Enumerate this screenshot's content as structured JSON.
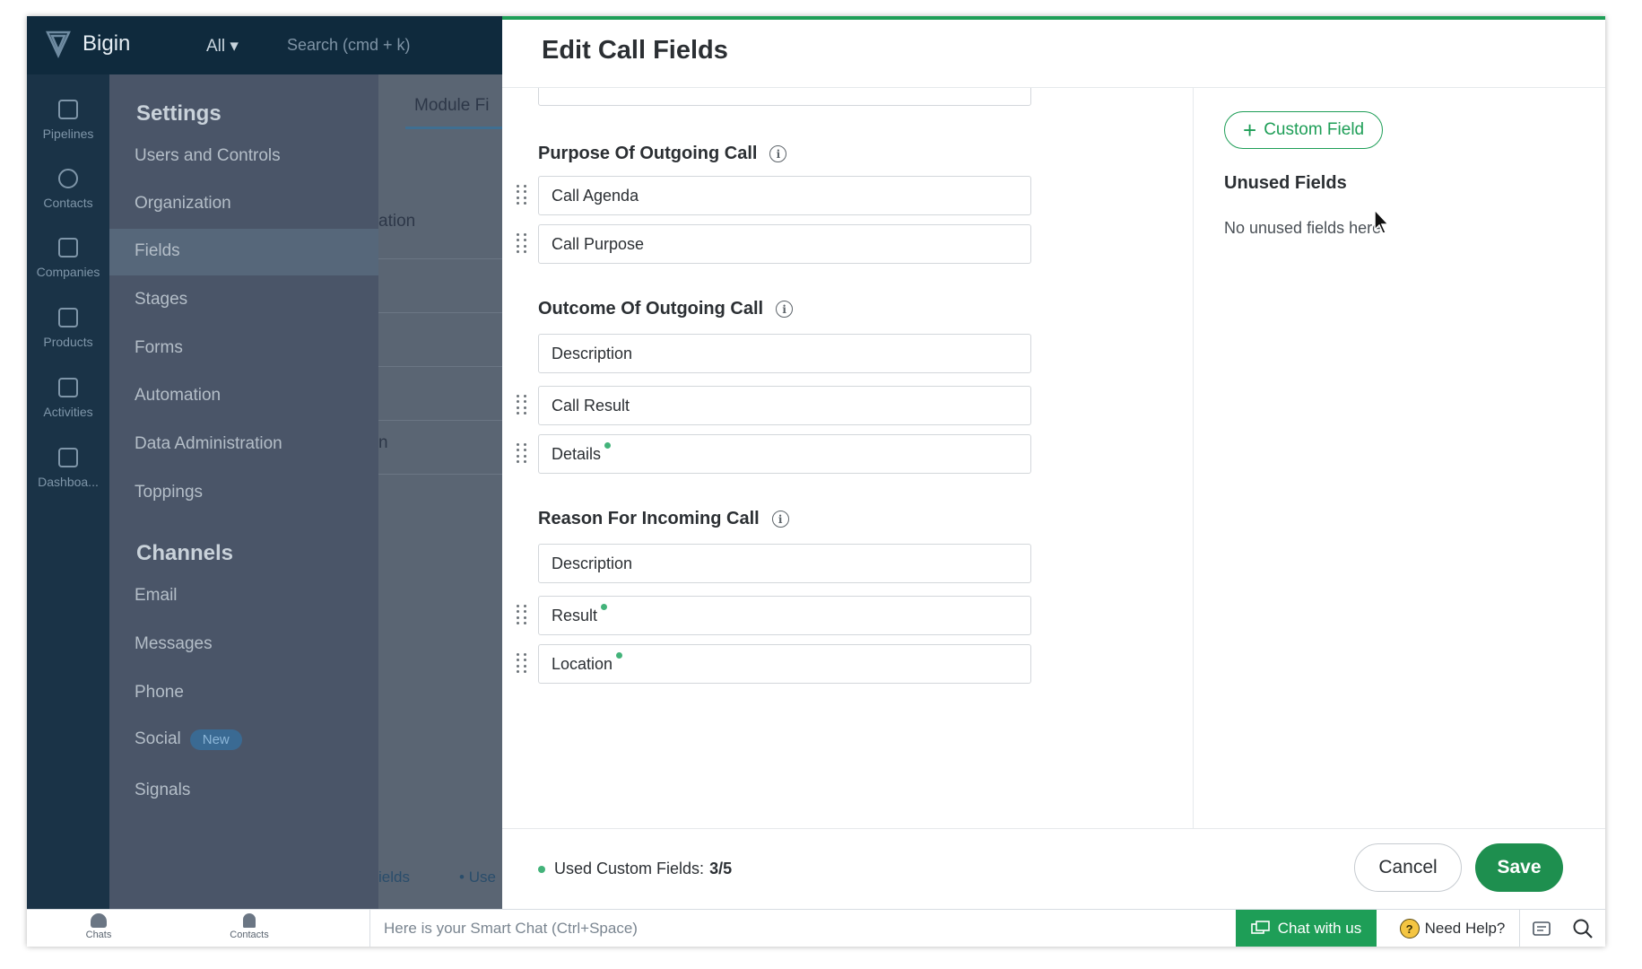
{
  "app": {
    "brand": "Bigin",
    "scope_select": "All",
    "search_placeholder": "Search (cmd + k)"
  },
  "iconnav": {
    "items": [
      {
        "label": "Pipelines",
        "icon": "pipelines-icon"
      },
      {
        "label": "Contacts",
        "icon": "contacts-icon"
      },
      {
        "label": "Companies",
        "icon": "companies-icon"
      },
      {
        "label": "Products",
        "icon": "products-icon"
      },
      {
        "label": "Activities",
        "icon": "activities-icon"
      },
      {
        "label": "Dashboa...",
        "icon": "dashboard-icon"
      }
    ]
  },
  "settings": {
    "title": "Settings",
    "items": [
      "Users and Controls",
      "Organization",
      "Fields",
      "Stages",
      "Forms",
      "Automation",
      "Data Administration",
      "Toppings"
    ],
    "channels_title": "Channels",
    "channels": [
      "Email",
      "Messages",
      "Phone",
      "Social",
      "Signals"
    ],
    "social_badge": "New"
  },
  "background": {
    "tab": "Module Fi",
    "text1": "ation",
    "text2": "n",
    "footer1": "ields",
    "footer2": "Use"
  },
  "modal": {
    "title": "Edit Call Fields",
    "sections": [
      {
        "title": "Purpose Of Outgoing Call",
        "fields": [
          {
            "label": "Call Agenda",
            "draggable": true,
            "custom": false
          },
          {
            "label": "Call Purpose",
            "draggable": true,
            "custom": false
          }
        ]
      },
      {
        "title": "Outcome Of Outgoing Call",
        "fields": [
          {
            "label": "Description",
            "draggable": false,
            "custom": false
          },
          {
            "label": "Call Result",
            "draggable": true,
            "custom": false
          },
          {
            "label": "Details",
            "draggable": true,
            "custom": true
          }
        ]
      },
      {
        "title": "Reason For Incoming Call",
        "fields": [
          {
            "label": "Description",
            "draggable": false,
            "custom": false
          },
          {
            "label": "Result",
            "draggable": true,
            "custom": true
          },
          {
            "label": "Location",
            "draggable": true,
            "custom": true
          }
        ]
      }
    ],
    "custom_field_button": "Custom Field",
    "unused_title": "Unused Fields",
    "unused_empty": "No unused fields here",
    "used_label": "Used Custom Fields:",
    "used_value": "3/5",
    "cancel": "Cancel",
    "save": "Save"
  },
  "bottombar": {
    "chats": "Chats",
    "contacts": "Contacts",
    "smart_chat_placeholder": "Here is your Smart Chat (Ctrl+Space)",
    "chat_with_us": "Chat with us",
    "need_help": "Need Help?"
  },
  "colors": {
    "accent": "#1e9e57",
    "save": "#1e8f4f",
    "custom_dot": "#43b37a"
  }
}
